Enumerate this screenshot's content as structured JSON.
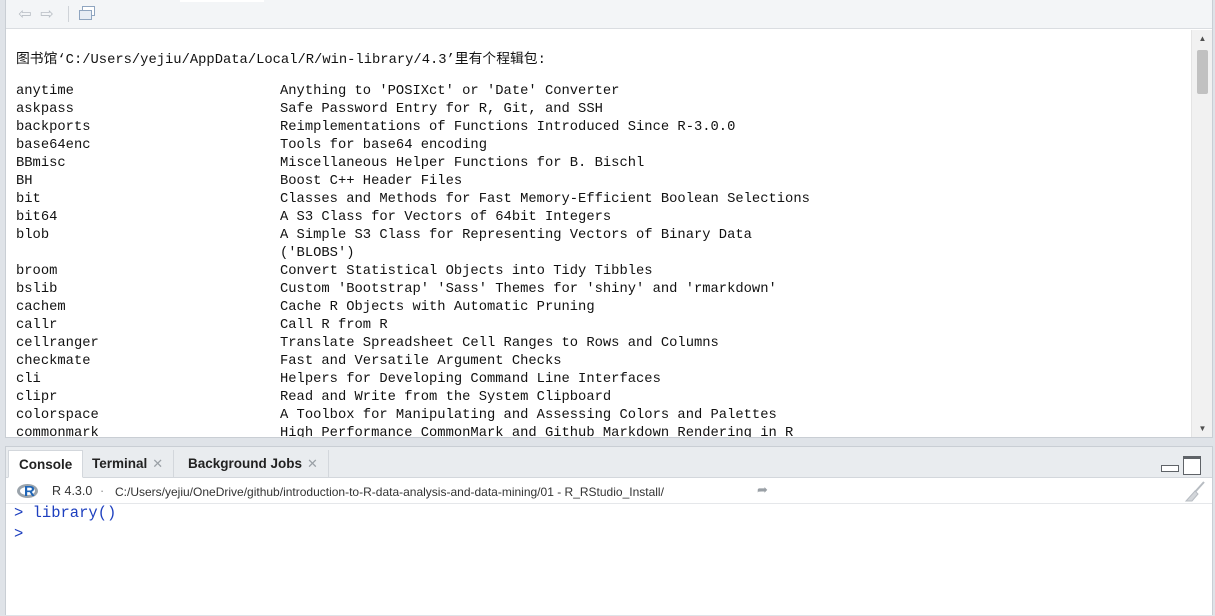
{
  "viewer": {
    "header": "图书馆‘C:/Users/yejiu/AppData/Local/R/win-library/4.3’里有个程辑包:",
    "packages": [
      {
        "name": "anytime",
        "title": [
          "Anything to 'POSIXct' or 'Date' Converter"
        ]
      },
      {
        "name": "askpass",
        "title": [
          "Safe Password Entry for R, Git, and SSH"
        ]
      },
      {
        "name": "backports",
        "title": [
          "Reimplementations of Functions Introduced Since R-3.0.0"
        ]
      },
      {
        "name": "base64enc",
        "title": [
          "Tools for base64 encoding"
        ]
      },
      {
        "name": "BBmisc",
        "title": [
          "Miscellaneous Helper Functions for B. Bischl"
        ]
      },
      {
        "name": "BH",
        "title": [
          "Boost C++ Header Files"
        ]
      },
      {
        "name": "bit",
        "title": [
          "Classes and Methods for Fast Memory-Efficient Boolean Selections"
        ]
      },
      {
        "name": "bit64",
        "title": [
          "A S3 Class for Vectors of 64bit Integers"
        ]
      },
      {
        "name": "blob",
        "title": [
          "A Simple S3 Class for Representing Vectors of Binary Data",
          "('BLOBS')"
        ]
      },
      {
        "name": "broom",
        "title": [
          "Convert Statistical Objects into Tidy Tibbles"
        ]
      },
      {
        "name": "bslib",
        "title": [
          "Custom 'Bootstrap' 'Sass' Themes for 'shiny' and 'rmarkdown'"
        ]
      },
      {
        "name": "cachem",
        "title": [
          "Cache R Objects with Automatic Pruning"
        ]
      },
      {
        "name": "callr",
        "title": [
          "Call R from R"
        ]
      },
      {
        "name": "cellranger",
        "title": [
          "Translate Spreadsheet Cell Ranges to Rows and Columns"
        ]
      },
      {
        "name": "checkmate",
        "title": [
          "Fast and Versatile Argument Checks"
        ]
      },
      {
        "name": "cli",
        "title": [
          "Helpers for Developing Command Line Interfaces"
        ]
      },
      {
        "name": "clipr",
        "title": [
          "Read and Write from the System Clipboard"
        ]
      },
      {
        "name": "colorspace",
        "title": [
          "A Toolbox for Manipulating and Assessing Colors and Palettes"
        ]
      },
      {
        "name": "commonmark",
        "title": [
          "High Performance CommonMark and Github Markdown Rendering in R"
        ]
      }
    ]
  },
  "console": {
    "tabs": [
      {
        "label": "Console",
        "closable": false
      },
      {
        "label": "Terminal",
        "closable": true
      },
      {
        "label": "Background Jobs",
        "closable": true
      }
    ],
    "r_version": "R 4.3.0",
    "separator": "·",
    "working_dir": "C:/Users/yejiu/OneDrive/github/introduction-to-R-data-analysis-and-data-mining/01 - R_RStudio_Install/",
    "lines": [
      "> library()",
      ">"
    ]
  },
  "colors": {
    "console_text": "#1d3fbf",
    "tab_bar": "#e9ecef",
    "toolbar_bg": "#f3f5f7"
  },
  "icons": {
    "back": "back-arrow-icon",
    "forward": "forward-arrow-icon",
    "show_in_window": "show-in-window-icon",
    "r_logo": "r-logo-icon",
    "goto_dir": "goto-directory-icon",
    "clear_console": "broom-icon"
  }
}
